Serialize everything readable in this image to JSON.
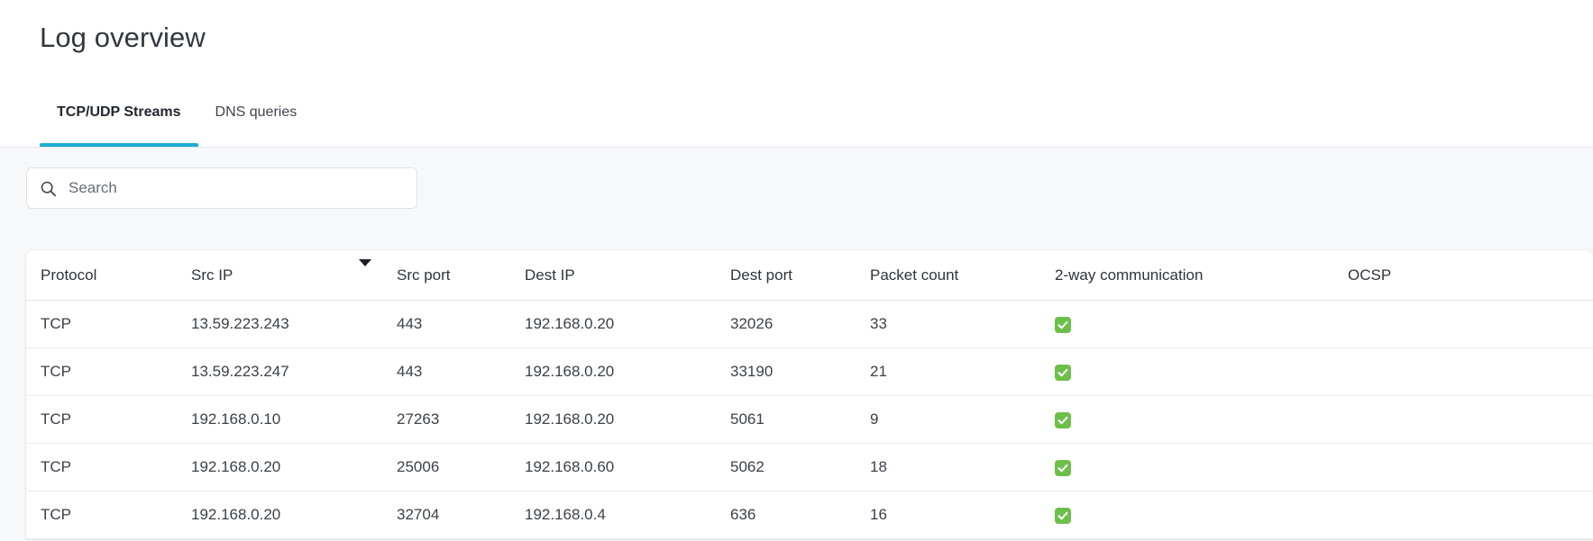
{
  "page": {
    "title": "Log overview"
  },
  "tabs": [
    {
      "label": "TCP/UDP Streams",
      "active": true
    },
    {
      "label": "DNS queries",
      "active": false
    }
  ],
  "search": {
    "placeholder": "Search",
    "value": "",
    "icon": "search-icon"
  },
  "table": {
    "sorted_column": "Src IP",
    "sort_direction": "descending",
    "sort_icon": "caret-down-icon",
    "columns": [
      "Protocol",
      "Src IP",
      "Src port",
      "Dest IP",
      "Dest port",
      "Packet count",
      "2-way communication",
      "OCSP"
    ],
    "rows": [
      {
        "protocol": "TCP",
        "src_ip": "13.59.223.243",
        "src_port": "443",
        "dest_ip": "192.168.0.20",
        "dest_port": "32026",
        "packet_count": "33",
        "two_way": true,
        "ocsp": ""
      },
      {
        "protocol": "TCP",
        "src_ip": "13.59.223.247",
        "src_port": "443",
        "dest_ip": "192.168.0.20",
        "dest_port": "33190",
        "packet_count": "21",
        "two_way": true,
        "ocsp": ""
      },
      {
        "protocol": "TCP",
        "src_ip": "192.168.0.10",
        "src_port": "27263",
        "dest_ip": "192.168.0.20",
        "dest_port": "5061",
        "packet_count": "9",
        "two_way": true,
        "ocsp": ""
      },
      {
        "protocol": "TCP",
        "src_ip": "192.168.0.20",
        "src_port": "25006",
        "dest_ip": "192.168.0.60",
        "dest_port": "5062",
        "packet_count": "18",
        "two_way": true,
        "ocsp": ""
      },
      {
        "protocol": "TCP",
        "src_ip": "192.168.0.20",
        "src_port": "32704",
        "dest_ip": "192.168.0.4",
        "dest_port": "636",
        "packet_count": "16",
        "two_way": true,
        "ocsp": ""
      }
    ]
  },
  "colors": {
    "accent": "#1eabd4",
    "checkbox_green": "#6cc04a",
    "content_background": "#f7f8f9",
    "card_background": "#ffffff",
    "text_primary": "#32373f",
    "border": "#e3e5e8"
  }
}
